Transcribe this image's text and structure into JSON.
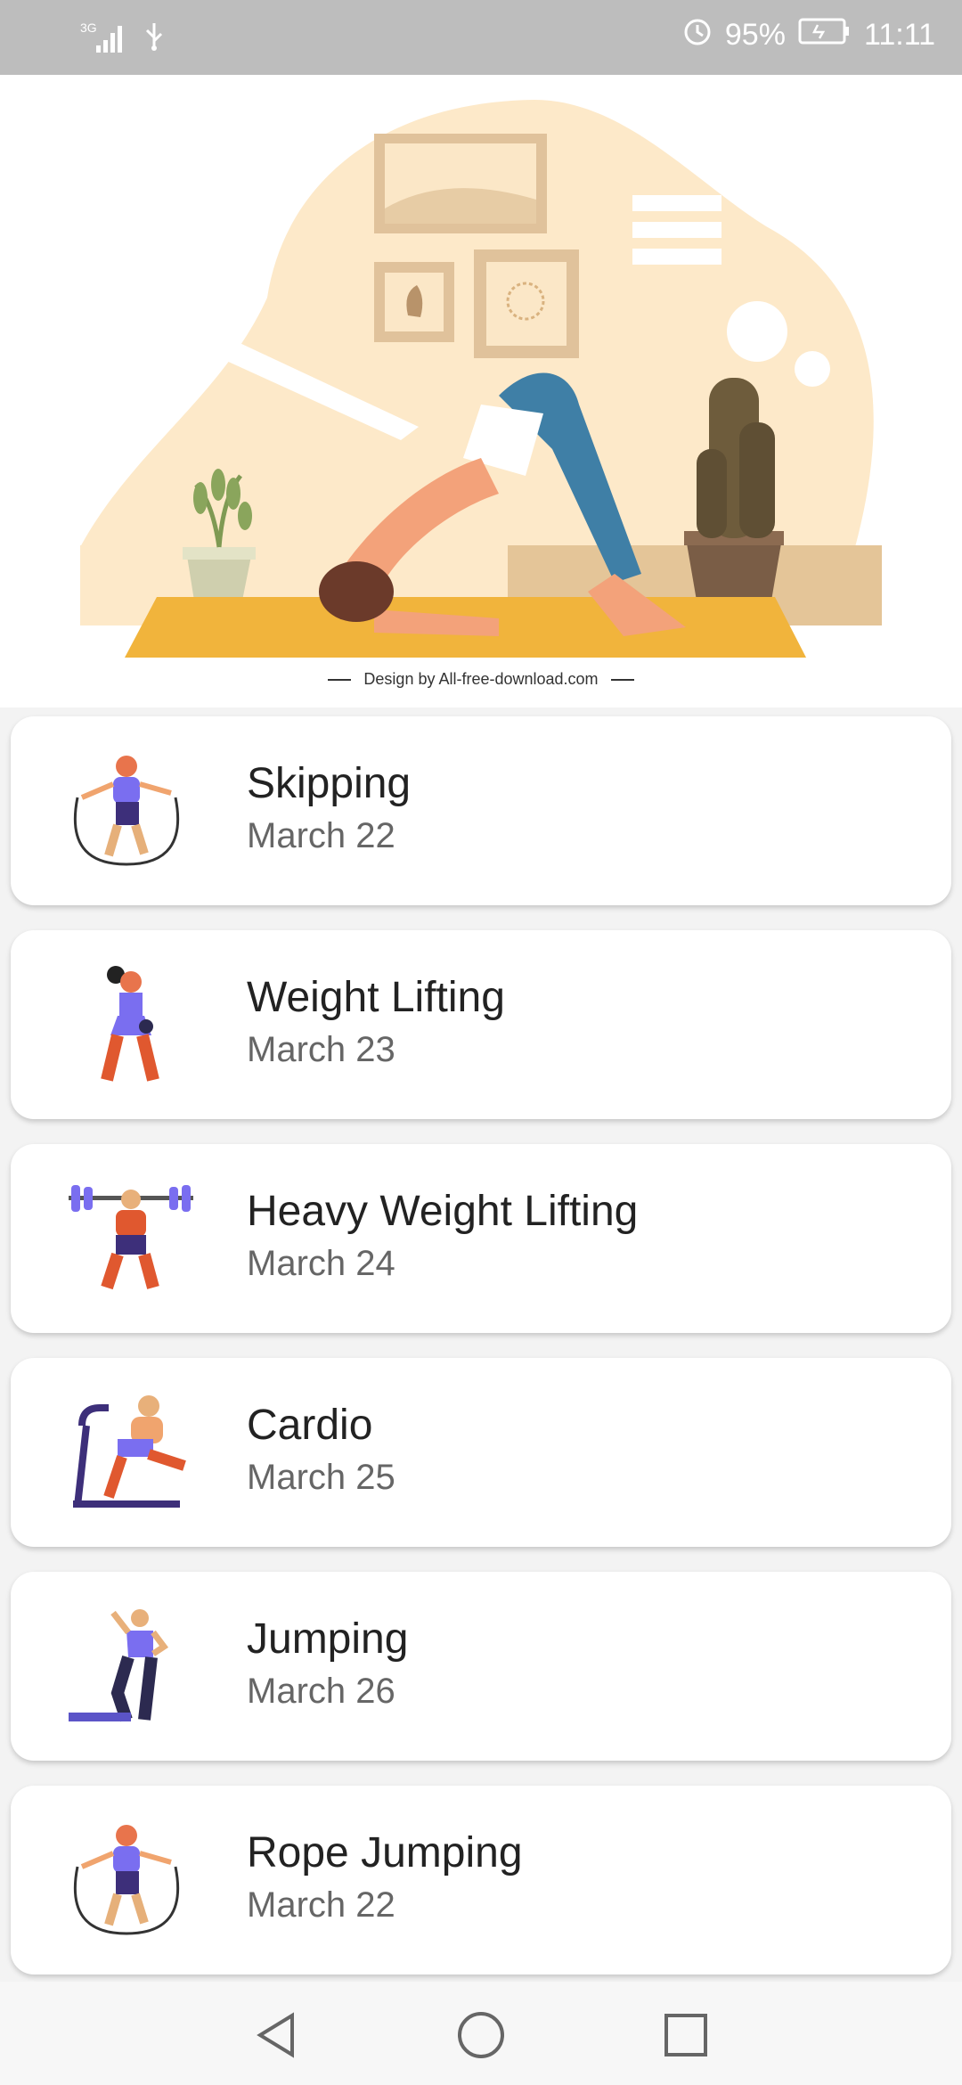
{
  "status_bar": {
    "network": "3G",
    "battery": "95%",
    "time": "11:11",
    "icons": [
      "signal-icon",
      "usb-icon",
      "alarm-icon",
      "battery-charging-icon"
    ]
  },
  "hero": {
    "credit": "Design by All-free-download.com",
    "colors": {
      "bg_shape": "#fde9c9",
      "mat": "#f1b43c",
      "floor": "#e4c598",
      "leggings": "#3f7fa6"
    }
  },
  "workouts": [
    {
      "title": "Skipping",
      "date": "March 22",
      "icon": "skipping-person-icon"
    },
    {
      "title": "Weight Lifting",
      "date": "March 23",
      "icon": "kettlebell-person-icon"
    },
    {
      "title": "Heavy Weight Lifting",
      "date": "March 24",
      "icon": "barbell-person-icon"
    },
    {
      "title": "Cardio",
      "date": "March 25",
      "icon": "treadmill-person-icon"
    },
    {
      "title": "Jumping",
      "date": "March 26",
      "icon": "step-jump-person-icon"
    },
    {
      "title": "Rope Jumping",
      "date": "March 22",
      "icon": "skipping-person-icon"
    }
  ],
  "nav": [
    "back-icon",
    "home-icon",
    "recents-icon"
  ]
}
